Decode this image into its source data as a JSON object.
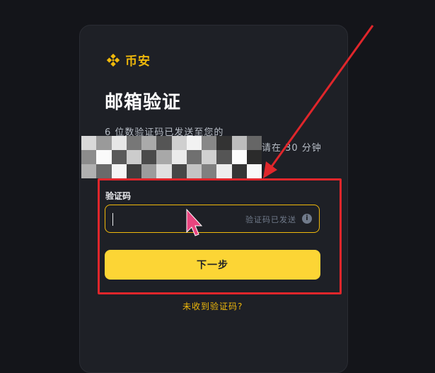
{
  "brand": {
    "name": "币安",
    "accent_color": "#f0b90b"
  },
  "page": {
    "title": "邮箱验证",
    "description": "6 位数验证码已发送至您的",
    "description_tail": "请在 30 分钟"
  },
  "form": {
    "code_label": "验证码",
    "code_value": "",
    "code_placeholder": "验证码已发送",
    "info_icon": "info-icon"
  },
  "actions": {
    "next_label": "下一步",
    "resend_label": "未收到验证码?"
  },
  "annotation": {
    "color": "#e0262b"
  }
}
